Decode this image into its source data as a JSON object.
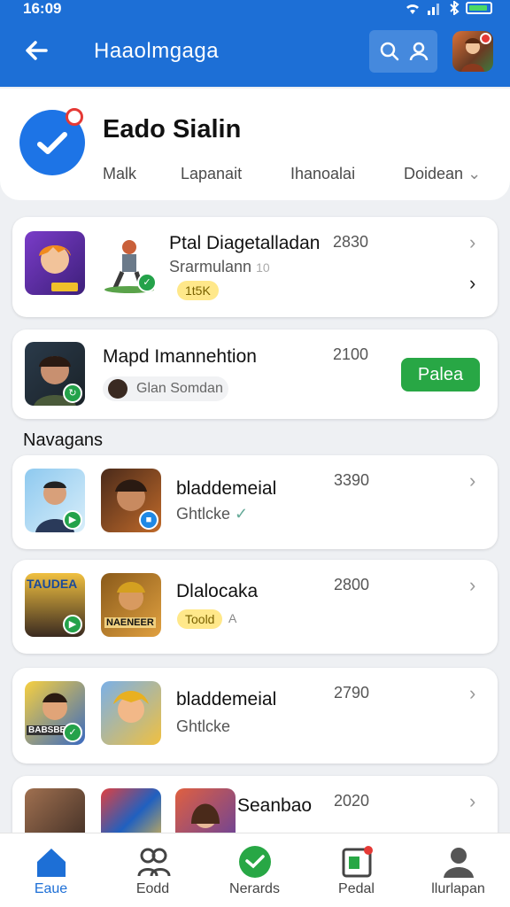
{
  "status": {
    "time": "16:09"
  },
  "header": {
    "title": "Haaolmgaga"
  },
  "profile": {
    "name": "Eado Sialin",
    "tabs": [
      "Malk",
      "Lapanait",
      "Ihanoalai",
      "Doidean"
    ]
  },
  "cards": [
    {
      "title": "Ptal Diagetalladan",
      "subtitle": "Srarmulann",
      "subtitle_extra": "10",
      "number": "2830",
      "pill": "1t5K"
    },
    {
      "title": "Mapd Imannehtion",
      "number": "2100",
      "chip": "Glan Somdan",
      "action": "Palea"
    }
  ],
  "section_title": "Navagans",
  "list": [
    {
      "title": "bladdemeial",
      "subtitle": "Ghtlcke",
      "number": "3390"
    },
    {
      "title": "Dlalocaka",
      "pill": "Toold",
      "pill_extra": "A",
      "number": "2800",
      "thumb_label_a": "TAUDEA",
      "thumb_label_b": "NAENEER"
    },
    {
      "title": "bladdemeial",
      "subtitle": "Ghtlcke",
      "number": "2790",
      "thumb_label_a": "BABSBEE"
    },
    {
      "title": "Seanbao",
      "number": "2020"
    }
  ],
  "nav": [
    {
      "label": "Eaue"
    },
    {
      "label": "Eodd"
    },
    {
      "label": "Nerards"
    },
    {
      "label": "Pedal"
    },
    {
      "label": "llurlapan"
    }
  ]
}
